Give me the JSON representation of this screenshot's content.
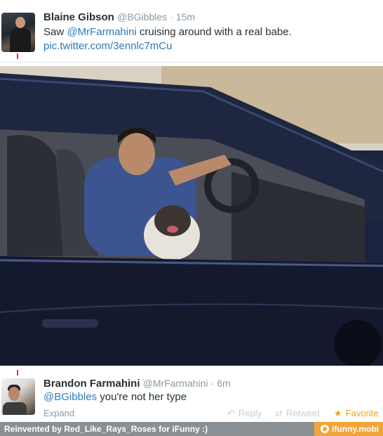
{
  "tweet1": {
    "name": "Blaine Gibson",
    "handle": "@BGibbles",
    "time": "· 15m",
    "text_prefix": "Saw ",
    "mention": "@MrFarmahini",
    "text_suffix": " cruising around with a real babe.",
    "link": "pic.twitter.com/3ennlc7mCu"
  },
  "tweet2": {
    "name": "Brandon Farmahini",
    "handle": "@MrFarmahini",
    "time": "· 6m",
    "mention": "@BGibbles",
    "text_suffix": " you're not her type",
    "expand": "Expand",
    "actions": {
      "reply": "Reply",
      "retweet": "Retweet",
      "favorite": "Favorite"
    }
  },
  "footer": {
    "credit": "Reinvented by Red_Like_Rays_Roses for iFunny :)",
    "brand": "ifunny.mobi"
  },
  "colors": {
    "link": "#2b7bb9",
    "muted": "#8899a6",
    "favorite": "#e6a617",
    "footer_bar": "#8a8f94",
    "brand_orange": "#f0a43a"
  },
  "icons": {
    "reply": "reply-icon",
    "retweet": "retweet-icon",
    "favorite": "star-icon"
  }
}
